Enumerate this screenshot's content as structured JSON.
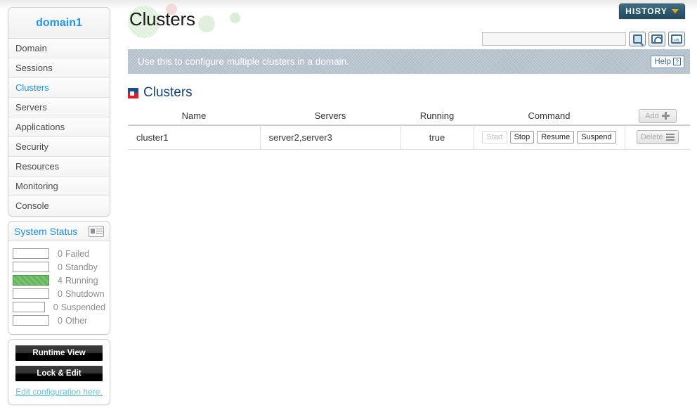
{
  "sidebar": {
    "domain_label": "domain1",
    "nav_items": [
      {
        "label": "Domain",
        "active": false
      },
      {
        "label": "Sessions",
        "active": false
      },
      {
        "label": "Clusters",
        "active": true
      },
      {
        "label": "Servers",
        "active": false
      },
      {
        "label": "Applications",
        "active": false
      },
      {
        "label": "Security",
        "active": false
      },
      {
        "label": "Resources",
        "active": false
      },
      {
        "label": "Monitoring",
        "active": false
      },
      {
        "label": "Console",
        "active": false
      }
    ],
    "system_status": {
      "title": "System Status",
      "icon": "monitor-icon",
      "rows": [
        {
          "count": "0",
          "label": "Failed",
          "filled": false
        },
        {
          "count": "0",
          "label": "Standby",
          "filled": false
        },
        {
          "count": "4",
          "label": "Running",
          "filled": true
        },
        {
          "count": "0",
          "label": "Shutdown",
          "filled": false
        },
        {
          "count": "0",
          "label": "Suspended",
          "filled": false
        },
        {
          "count": "0",
          "label": "Other",
          "filled": false
        }
      ]
    },
    "actions": {
      "runtime_view": "Runtime View",
      "lock_and_edit": "Lock & Edit",
      "edit_config_link": "Edit configuration here."
    }
  },
  "header": {
    "page_title": "Clusters",
    "history_label": "HISTORY",
    "search_value": "",
    "search_placeholder": "",
    "tools": [
      {
        "name": "search-icon",
        "title": "Search"
      },
      {
        "name": "refresh-icon",
        "title": "Refresh"
      },
      {
        "name": "xml-export-icon",
        "title": "Export XML"
      }
    ]
  },
  "banner": {
    "text": "Use this to configure multiple clusters in a domain.",
    "help_label": "Help"
  },
  "section": {
    "icon": "clusters-icon",
    "title": "Clusters"
  },
  "table": {
    "columns": [
      "Name",
      "Servers",
      "Running",
      "Command"
    ],
    "add_label": "Add",
    "delete_label": "Delete",
    "rows": [
      {
        "name": "cluster1",
        "servers": "server2,server3",
        "running": "true",
        "commands": [
          {
            "label": "Start",
            "disabled": true
          },
          {
            "label": "Stop",
            "disabled": false
          },
          {
            "label": "Resume",
            "disabled": false
          },
          {
            "label": "Suspend",
            "disabled": false
          }
        ]
      }
    ]
  },
  "colors": {
    "accent_blue": "#1e90e8",
    "section_blue": "#16447c",
    "banner_bg": "#aebcc8",
    "running_green": "#63b45c",
    "history_teal": "#2e5a6e",
    "chevron_orange": "#f0a020",
    "link_teal": "#5ec4d0"
  }
}
